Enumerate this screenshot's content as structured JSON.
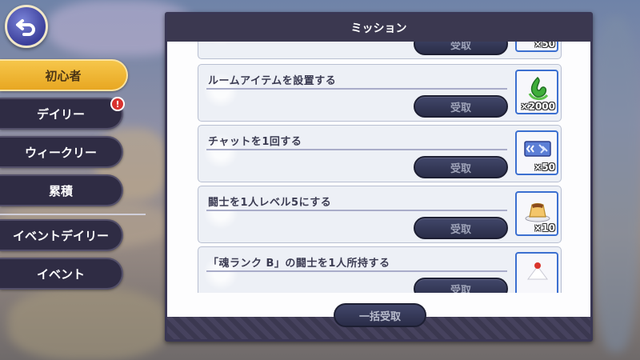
{
  "header": {
    "title": "ミッション",
    "back_symbol": "⮌"
  },
  "sidebar": {
    "tabs": [
      {
        "label": "初心者",
        "active": true
      },
      {
        "label": "デイリー",
        "alert": "!"
      },
      {
        "label": "ウィークリー"
      },
      {
        "label": "累積"
      },
      {
        "label": "イベントデイリー"
      },
      {
        "label": "イベント"
      }
    ]
  },
  "missions": [
    {
      "title": "",
      "button": "受取",
      "reward_icon": "generic-reward-icon",
      "reward_qty": "×50"
    },
    {
      "title": "ルームアイテムを設置する",
      "button": "受取",
      "reward_icon": "green-crystal-icon",
      "reward_qty": "×2000"
    },
    {
      "title": "チャットを1回する",
      "button": "受取",
      "reward_icon": "ticket-icon",
      "reward_qty": "×50"
    },
    {
      "title": "闘士を1人レベル5にする",
      "button": "受取",
      "reward_icon": "pudding-icon",
      "reward_qty": "×10"
    },
    {
      "title": "「魂ランク B」の闘士を1人所持する",
      "button": "受取",
      "reward_icon": "cake-icon",
      "reward_qty": ""
    }
  ],
  "footer": {
    "claim_all": "一括受取"
  },
  "colors": {
    "accent": "#f3b936",
    "panel_header": "#3b3850",
    "button": "#2f3350",
    "alert": "#d8322f"
  }
}
